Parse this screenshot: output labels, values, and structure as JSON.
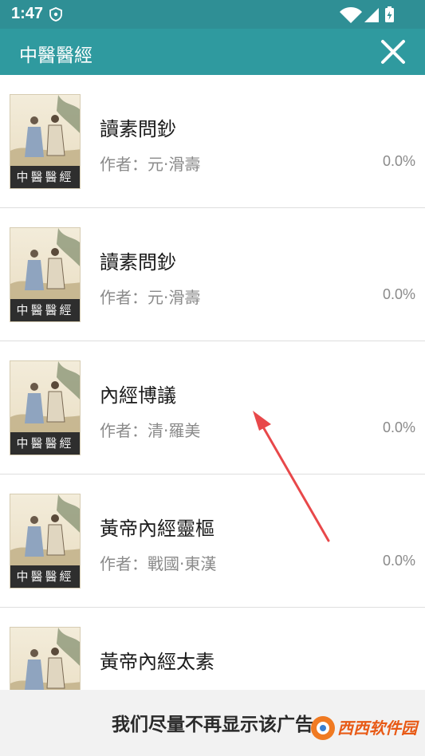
{
  "status_bar": {
    "time": "1:47",
    "icons": [
      "shield-icon",
      "wifi-icon",
      "signal-icon",
      "battery-charging-icon"
    ]
  },
  "header": {
    "title": "中醫醫經",
    "close_icon": "close-icon"
  },
  "books": [
    {
      "title": "讀素問鈔",
      "author": "作者：元·滑壽",
      "progress": "0.0%",
      "cover_label": "中醫醫經"
    },
    {
      "title": "讀素問鈔",
      "author": "作者：元·滑壽",
      "progress": "0.0%",
      "cover_label": "中醫醫經"
    },
    {
      "title": "內經博議",
      "author": "作者：清·羅美",
      "progress": "0.0%",
      "cover_label": "中醫醫經"
    },
    {
      "title": "黃帝內經靈樞",
      "author": "作者：戰國·東漢",
      "progress": "0.0%",
      "cover_label": "中醫醫經"
    },
    {
      "title": "黃帝內經太素",
      "author": "",
      "progress": "",
      "cover_label": ""
    }
  ],
  "ad": {
    "text": "我们尽量不再显示该广告",
    "watermark": "西西软件园"
  },
  "colors": {
    "app_bar": "#2f9a9f",
    "status_bar": "#2f8f95",
    "arrow": "#e8484a"
  }
}
